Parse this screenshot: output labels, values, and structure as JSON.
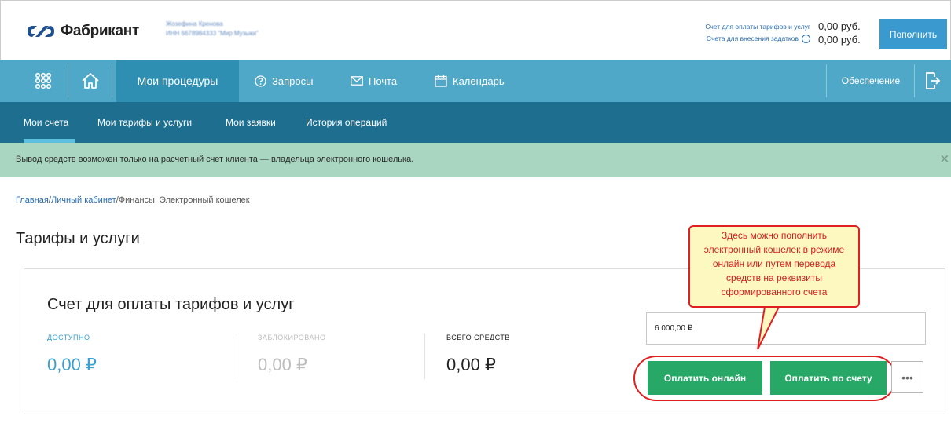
{
  "header": {
    "brand": "Фабрикант",
    "user_name": "Жозефина Кренова",
    "user_org": "ИНН 6678984333 \"Мир Музыки\"",
    "account_label_1": "Счет для оплаты тарифов и услуг",
    "account_label_2": "Счета для внесения задатков",
    "account_amount_1": "0,00 руб.",
    "account_amount_2": "0,00 руб.",
    "topup_label": "Пополнить",
    "info_icon": "ⓘ"
  },
  "nav": {
    "procedures": "Мои процедуры",
    "requests": "Запросы",
    "mail": "Почта",
    "calendar": "Календарь",
    "security": "Обеспечение"
  },
  "subnav": {
    "items": [
      "Мои счета",
      "Мои тарифы и услуги",
      "Мои заявки",
      "История операций"
    ]
  },
  "alert": {
    "text": "Вывод средств возможен только на расчетный счет клиента — владельца электронного кошелька.",
    "close": "×"
  },
  "breadcrumb": {
    "home": "Главная",
    "cabinet": "Личный кабинет",
    "current": "Финансы: Электронный кошелек",
    "sep": "/"
  },
  "page_title": "Тарифы и услуги",
  "card": {
    "title": "Счет для оплаты тарифов и услуг",
    "stats": [
      {
        "label": "ДОСТУПНО",
        "value": "0,00 ₽",
        "color": "#3aa0d0"
      },
      {
        "label": "ЗАБЛОКИРОВАНО",
        "value": "0,00 ₽",
        "color": "#bdbdbd"
      },
      {
        "label": "ВСЕГО СРЕДСТВ",
        "value": "0,00 ₽",
        "color": "#222222"
      }
    ],
    "amount_value": "6 000,00 ₽",
    "pay_online": "Оплатить онлайн",
    "pay_invoice": "Оплатить по счету",
    "more": "•••"
  },
  "callout": {
    "lines": [
      "Здесь можно пополнить",
      "электронный кошелек в режиме",
      "онлайн или путем перевода",
      "средств на реквизиты",
      "сформированного счета"
    ]
  },
  "colors": {
    "nav": "#4fa8c8",
    "subnav": "#1e6f8f",
    "alert": "#a8d6c1",
    "green": "#27a866",
    "annotation": "#e02020"
  }
}
